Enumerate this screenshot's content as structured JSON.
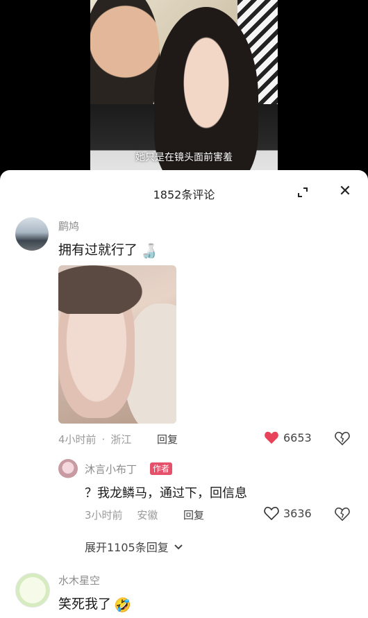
{
  "video": {
    "caption": "她只是在镜头面前害羞"
  },
  "sheet": {
    "title": "1852条评论"
  },
  "comments": [
    {
      "username": "鹛鸠",
      "text": "拥有过就行了",
      "emoji": "🍶",
      "time": "4小时前",
      "location": "浙江",
      "reply_label": "回复",
      "likes": "6653",
      "liked": true
    },
    {
      "username": "水木星空",
      "text": "笑死我了",
      "emoji": "🤣"
    }
  ],
  "reply": {
    "username": "沐言小布丁",
    "badge": "作者",
    "text": "？我龙鳞马，通过下，回信息",
    "time": "3小时前",
    "location": "安徽",
    "reply_label": "回复",
    "likes": "3636",
    "liked": false
  },
  "expand_replies": "展开1105条回复",
  "colors": {
    "heart_liked": "#e84459",
    "badge": "#e5506b",
    "meta_text": "#9a9a9a"
  }
}
